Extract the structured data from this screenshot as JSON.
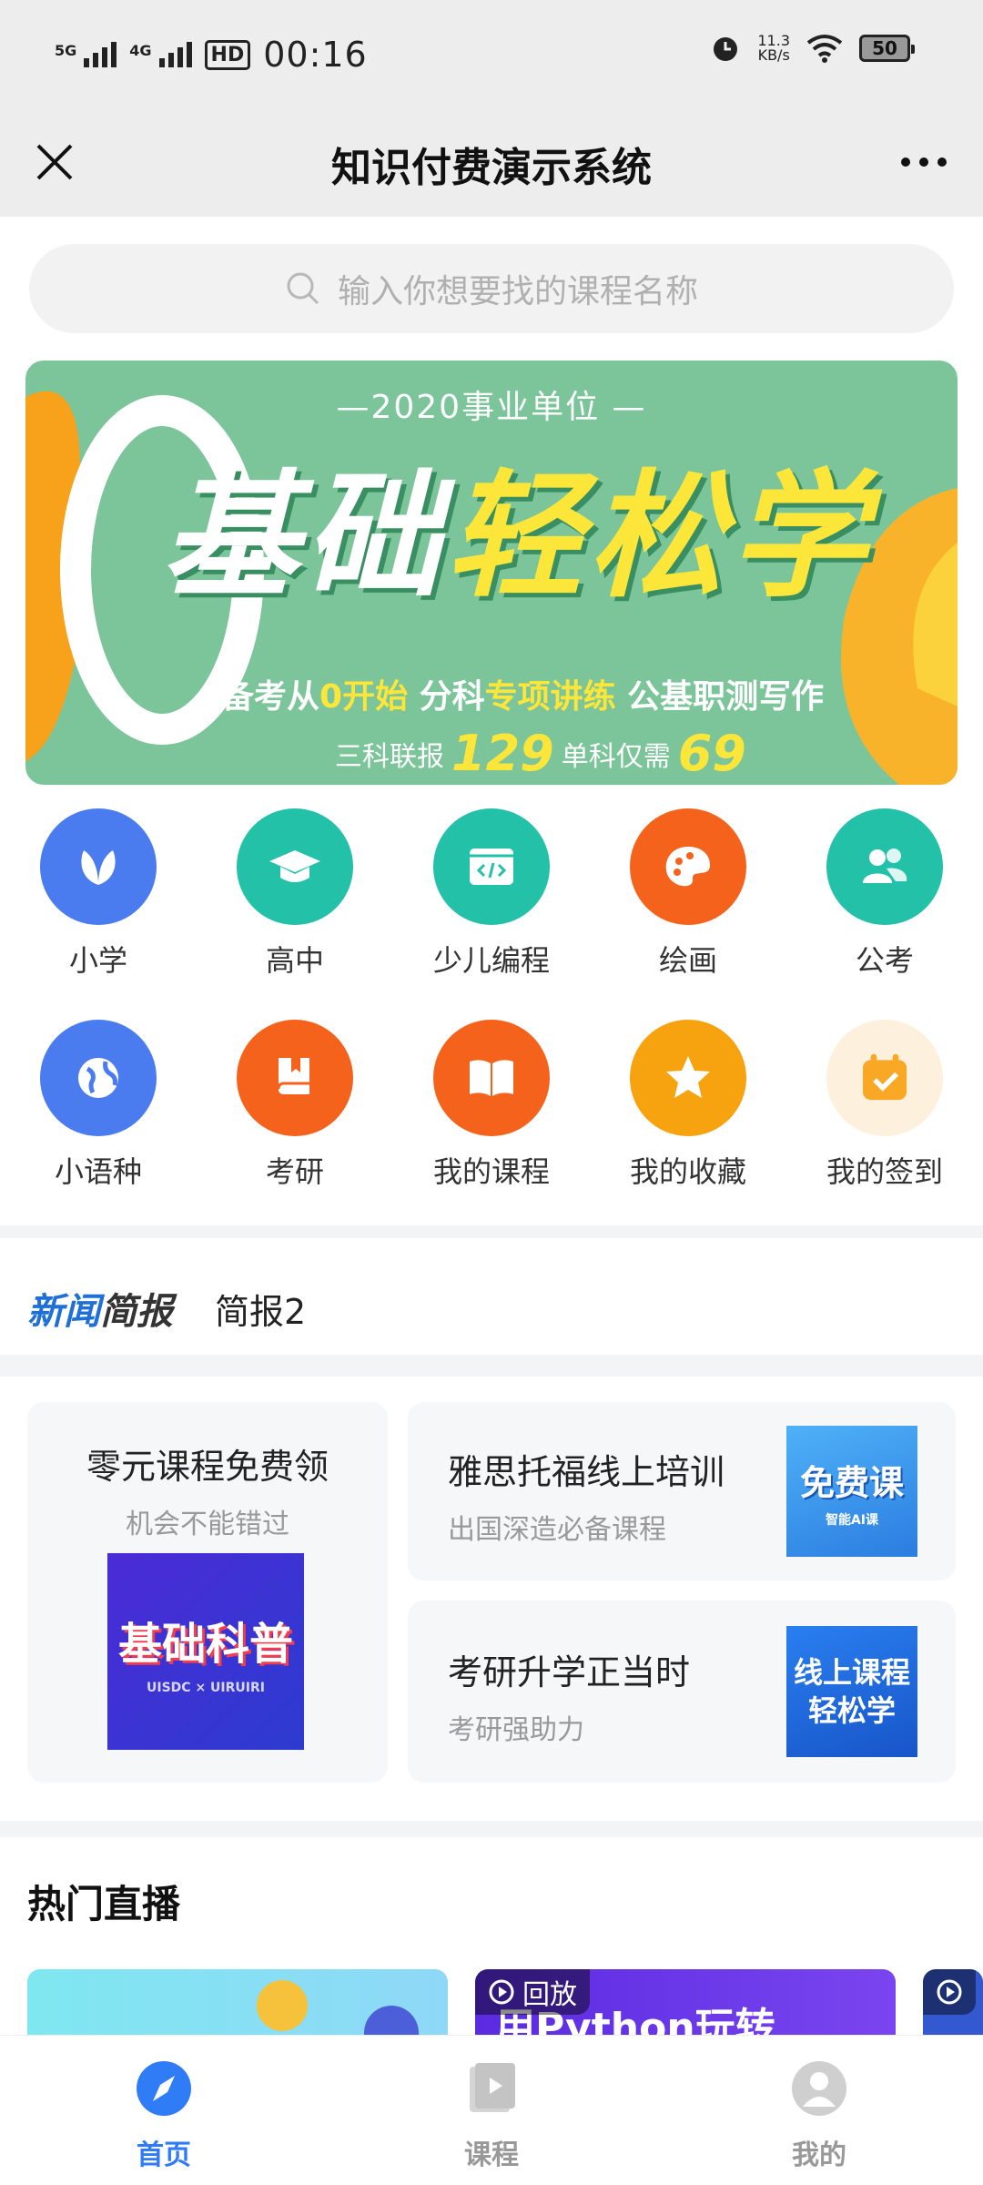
{
  "status_bar": {
    "time": "00:16",
    "net1": "5G",
    "net2": "4G",
    "hd": "HD",
    "speed": "11.3",
    "speed_unit": "KB/s",
    "battery": "50"
  },
  "nav": {
    "title": "知识付费演示系统"
  },
  "search": {
    "placeholder": "输入你想要找的课程名称"
  },
  "banner": {
    "top_line": "—2020事业单位 —",
    "headline_white": "基础",
    "headline_yellow": "轻松学",
    "sub_a": "备考从",
    "sub_b": "0开始",
    "sub_c": " 分科",
    "sub_d": "专项讲练",
    "sub_e": " 公基职测写作",
    "price_a": "三科联报",
    "price_b": "129",
    "price_c": "单科仅需",
    "price_d": "69"
  },
  "categories": [
    {
      "label": "小学",
      "icon": "leaf-icon",
      "color": "#4a7cf0"
    },
    {
      "label": "高中",
      "icon": "graduation-cap-icon",
      "color": "#23c1a8"
    },
    {
      "label": "少儿编程",
      "icon": "code-window-icon",
      "color": "#23c1a8"
    },
    {
      "label": "绘画",
      "icon": "palette-icon",
      "color": "#f5621c"
    },
    {
      "label": "公考",
      "icon": "people-icon",
      "color": "#23c1a8"
    },
    {
      "label": "小语种",
      "icon": "globe-icon",
      "color": "#4a7cf0"
    },
    {
      "label": "考研",
      "icon": "book-icon",
      "color": "#f5621c"
    },
    {
      "label": "我的课程",
      "icon": "open-book-icon",
      "color": "#f5621c"
    },
    {
      "label": "我的收藏",
      "icon": "star-icon",
      "color": "#f7a20f"
    },
    {
      "label": "我的签到",
      "icon": "calendar-check-icon",
      "color": "#fde9c8"
    }
  ],
  "news": {
    "logo_a": "新闻",
    "logo_b": "简报",
    "text": "简报2"
  },
  "promo": {
    "left": {
      "title": "零元课程免费领",
      "subtitle": "机会不能错过",
      "thumb_text": "基础科普",
      "thumb_small": "UISDC × UIRUIRI"
    },
    "right": [
      {
        "title": "雅思托福线上培训",
        "subtitle": "出国深造必备课程",
        "thumb_text": "免费课",
        "thumb_small": "智能AI课"
      },
      {
        "title": "考研升学正当时",
        "subtitle": "考研强助力",
        "thumb_text": "线上课程 轻松学"
      }
    ]
  },
  "live": {
    "title": "热门直播",
    "replay": "回放",
    "card2_text": "用Python玩转"
  },
  "tabs": [
    {
      "label": "首页",
      "icon": "compass-icon",
      "active": true
    },
    {
      "label": "课程",
      "icon": "course-icon",
      "active": false
    },
    {
      "label": "我的",
      "icon": "profile-icon",
      "active": false
    }
  ],
  "colors": {
    "accent": "#2f7cf6",
    "banner_green": "#7cc59a",
    "banner_yellow": "#fde63a"
  }
}
